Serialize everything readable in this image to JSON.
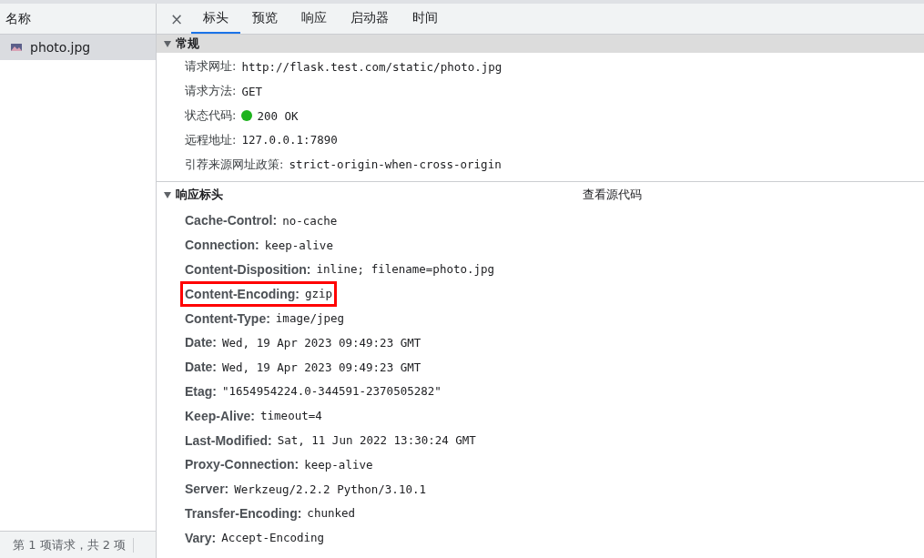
{
  "requests": {
    "column": "名称",
    "items": [
      {
        "name": "photo.jpg",
        "selected": true
      }
    ],
    "status": "第 1 项请求，共 2 项"
  },
  "tabs": [
    {
      "label": "标头",
      "selected": true
    },
    {
      "label": "预览",
      "selected": false
    },
    {
      "label": "响应",
      "selected": false
    },
    {
      "label": "启动器",
      "selected": false
    },
    {
      "label": "时间",
      "selected": false
    }
  ],
  "close": "×",
  "general": {
    "title": "常规",
    "expanded": true,
    "rows": [
      {
        "name": "请求网址:",
        "value": "http://flask.test.com/static/photo.jpg"
      },
      {
        "name": "请求方法:",
        "value": "GET"
      },
      {
        "name": "状态代码:",
        "value": "200 OK",
        "color": "#1db31d"
      },
      {
        "name": "远程地址:",
        "value": "127.0.0.1:7890"
      },
      {
        "name": "引荐来源网址政策:",
        "value": "strict-origin-when-cross-origin"
      }
    ]
  },
  "response_headers": {
    "title": "响应标头",
    "expanded": true,
    "view_source": "查看源代码",
    "rows": [
      {
        "name": "Cache-Control:",
        "value": "no-cache",
        "highlighted": false
      },
      {
        "name": "Connection:",
        "value": "keep-alive",
        "highlighted": false
      },
      {
        "name": "Content-Disposition:",
        "value": "inline; filename=photo.jpg",
        "highlighted": false
      },
      {
        "name": "Content-Encoding:",
        "value": "gzip",
        "highlighted": true
      },
      {
        "name": "Content-Type:",
        "value": "image/jpeg",
        "highlighted": false
      },
      {
        "name": "Date:",
        "value": "Wed, 19 Apr 2023 09:49:23 GMT",
        "highlighted": false
      },
      {
        "name": "Date:",
        "value": "Wed, 19 Apr 2023 09:49:23 GMT",
        "highlighted": false
      },
      {
        "name": "Etag:",
        "value": "\"1654954224.0-344591-2370505282\"",
        "highlighted": false
      },
      {
        "name": "Keep-Alive:",
        "value": "timeout=4",
        "highlighted": false
      },
      {
        "name": "Last-Modified:",
        "value": "Sat, 11 Jun 2022 13:30:24 GMT",
        "highlighted": false
      },
      {
        "name": "Proxy-Connection:",
        "value": "keep-alive",
        "highlighted": false
      },
      {
        "name": "Server:",
        "value": "Werkzeug/2.2.2 Python/3.10.1",
        "highlighted": false
      },
      {
        "name": "Transfer-Encoding:",
        "value": "chunked",
        "highlighted": false
      },
      {
        "name": "Vary:",
        "value": "Accept-Encoding",
        "highlighted": false
      }
    ]
  }
}
